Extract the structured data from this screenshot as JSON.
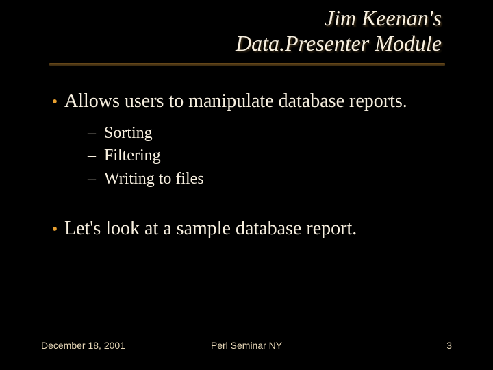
{
  "title": {
    "line1": "Jim Keenan's",
    "line2": "Data.Presenter Module"
  },
  "bullets": [
    {
      "text": "Allows users to manipulate database reports.",
      "subs": [
        "Sorting",
        "Filtering",
        "Writing to files"
      ]
    },
    {
      "text": "Let's look at a sample database report.",
      "subs": []
    }
  ],
  "footer": {
    "date": "December 18, 2001",
    "center": "Perl Seminar NY",
    "page": "3"
  }
}
